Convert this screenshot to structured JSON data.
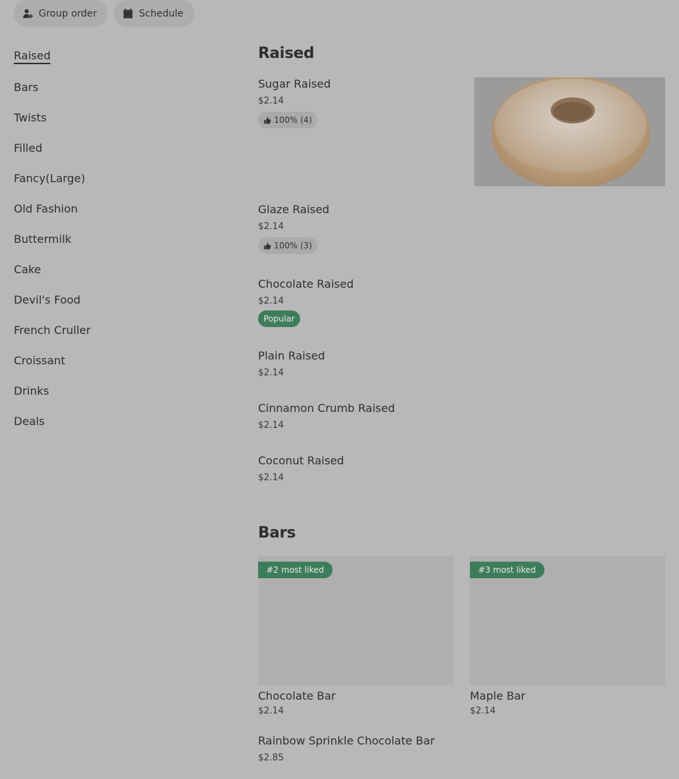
{
  "top_actions": {
    "group_order_label": "Group order",
    "schedule_label": "Schedule"
  },
  "sidebar": {
    "items": [
      {
        "label": "Raised"
      },
      {
        "label": "Bars"
      },
      {
        "label": "Twists"
      },
      {
        "label": "Filled"
      },
      {
        "label": "Fancy(Large)"
      },
      {
        "label": "Old Fashion"
      },
      {
        "label": "Buttermilk"
      },
      {
        "label": "Cake"
      },
      {
        "label": "Devil's Food"
      },
      {
        "label": "French Cruller"
      },
      {
        "label": "Croissant"
      },
      {
        "label": "Drinks"
      },
      {
        "label": "Deals"
      }
    ]
  },
  "raised": {
    "title": "Raised",
    "items": [
      {
        "name": "Sugar Raised",
        "price": "$2.14",
        "rating": "100% (4)"
      },
      {
        "name": "Glaze Raised",
        "price": "$2.14",
        "rating": "100% (3)"
      },
      {
        "name": "Chocolate Raised",
        "price": "$2.14",
        "badge": "Popular"
      },
      {
        "name": "Plain Raised",
        "price": "$2.14"
      },
      {
        "name": "Cinnamon Crumb Raised",
        "price": "$2.14"
      },
      {
        "name": "Coconut Raised",
        "price": "$2.14"
      }
    ]
  },
  "bars": {
    "title": "Bars",
    "cards": [
      {
        "badge": "#2 most liked",
        "name": "Chocolate Bar",
        "price": "$2.14"
      },
      {
        "badge": "#3 most liked",
        "name": "Maple Bar",
        "price": "$2.14"
      }
    ],
    "items": [
      {
        "name": "Rainbow Sprinkle Chocolate Bar",
        "price": "$2.85"
      }
    ]
  },
  "colors": {
    "background": "#b8b8b8",
    "badge_green": "#3d7d5b"
  }
}
